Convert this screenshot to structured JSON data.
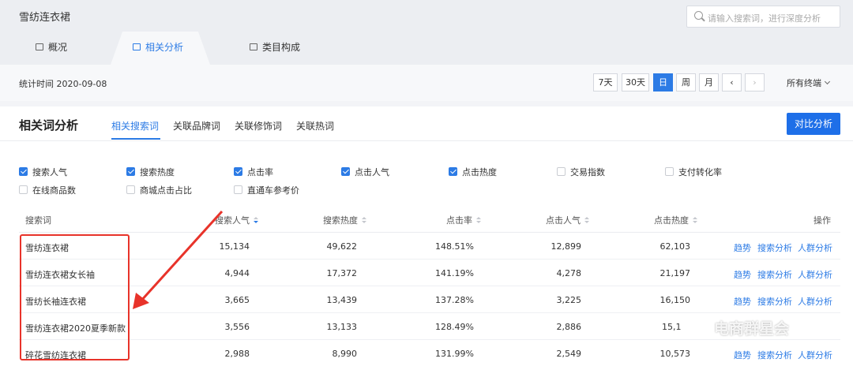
{
  "header": {
    "title": "雪纺连衣裙",
    "search_placeholder": "请输入搜索词，进行深度分析"
  },
  "tabs": [
    {
      "label": "概况",
      "icon": "bag-icon"
    },
    {
      "label": "相关分析",
      "icon": "bag-icon",
      "active": true
    },
    {
      "label": "类目构成",
      "icon": "bag-icon"
    }
  ],
  "statbar": {
    "time_label": "统计时间 2020-09-08",
    "range_buttons": [
      "7天",
      "30天",
      "日",
      "周",
      "月"
    ],
    "selected_range": "日",
    "prev_icon": "chevron-left-icon",
    "next_icon": "chevron-right-icon",
    "terminal": "所有终端"
  },
  "section": {
    "title": "相关词分析",
    "subtabs": [
      "相关搜索词",
      "关联品牌词",
      "关联修饰词",
      "关联热词"
    ],
    "compare_button": "对比分析"
  },
  "metrics": [
    {
      "label": "搜索人气",
      "checked": true
    },
    {
      "label": "搜索热度",
      "checked": true
    },
    {
      "label": "点击率",
      "checked": true
    },
    {
      "label": "点击人气",
      "checked": true
    },
    {
      "label": "点击热度",
      "checked": true
    },
    {
      "label": "交易指数",
      "checked": false
    },
    {
      "label": "支付转化率",
      "checked": false
    },
    {
      "label": "在线商品数",
      "checked": false
    },
    {
      "label": "商城点击占比",
      "checked": false
    },
    {
      "label": "直通车参考价",
      "checked": false
    }
  ],
  "table": {
    "columns": [
      "搜索词",
      "搜索人气",
      "搜索热度",
      "点击率",
      "点击人气",
      "点击热度",
      "操作"
    ],
    "rows": [
      {
        "keyword": "雪纺连衣裙",
        "search_pop": "15,134",
        "search_heat": "49,622",
        "ctr": "148.51%",
        "click_pop": "12,899",
        "click_heat": "62,103"
      },
      {
        "keyword": "雪纺连衣裙女长袖",
        "search_pop": "4,944",
        "search_heat": "17,372",
        "ctr": "141.19%",
        "click_pop": "4,278",
        "click_heat": "21,197"
      },
      {
        "keyword": "雪纺长袖连衣裙",
        "search_pop": "3,665",
        "search_heat": "13,439",
        "ctr": "137.28%",
        "click_pop": "3,225",
        "click_heat": "16,150"
      },
      {
        "keyword": "雪纺连衣裙2020夏季新款",
        "search_pop": "3,556",
        "search_heat": "13,133",
        "ctr": "128.49%",
        "click_pop": "2,886",
        "click_heat": "15,1"
      },
      {
        "keyword": "碎花雪纺连衣裙",
        "search_pop": "2,988",
        "search_heat": "8,990",
        "ctr": "131.99%",
        "click_pop": "2,549",
        "click_heat": "10,573"
      }
    ],
    "actions": [
      "趋势",
      "搜索分析",
      "人群分析"
    ]
  },
  "watermark": "电商群星会",
  "colors": {
    "accent": "#2c7be5",
    "annotation": "#e8332a"
  }
}
